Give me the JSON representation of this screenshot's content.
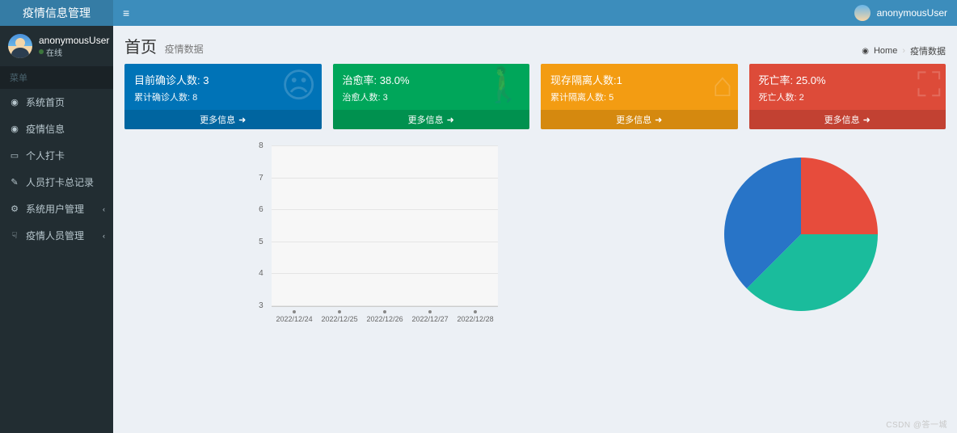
{
  "app": {
    "name": "疫情信息管理"
  },
  "user": {
    "name": "anonymousUser",
    "status": "在线"
  },
  "topbar": {
    "username": "anonymousUser"
  },
  "sidebar": {
    "menu_header": "菜单",
    "items": [
      {
        "icon": "dashboard-icon",
        "label": "系统首页"
      },
      {
        "icon": "dashboard-icon",
        "label": "疫情信息"
      },
      {
        "icon": "laptop-icon",
        "label": "个人打卡"
      },
      {
        "icon": "edit-icon",
        "label": "人员打卡总记录"
      },
      {
        "icon": "cogs-icon",
        "label": "系统用户管理",
        "caret": true
      },
      {
        "icon": "hand-icon",
        "label": "疫情人员管理",
        "caret": true
      }
    ]
  },
  "header": {
    "title": "首页",
    "subtitle": "疫情数据",
    "breadcrumb_home": "Home",
    "breadcrumb_current": "疫情数据"
  },
  "cards": [
    {
      "title": "目前确诊人数:  3",
      "sub": "累计确诊人数:  8",
      "footer": "更多信息",
      "color": "c-blue",
      "bg_icon": "☹"
    },
    {
      "title": "治愈率:  38.0%",
      "sub": "治愈人数:  3",
      "footer": "更多信息",
      "color": "c-green",
      "bg_icon": "🚶"
    },
    {
      "title": "现存隔离人数:1",
      "sub": "累计隔离人数:  5",
      "footer": "更多信息",
      "color": "c-orange",
      "bg_icon": "⌂"
    },
    {
      "title": "死亡率:  25.0%",
      "sub": "死亡人数:  2",
      "footer": "更多信息",
      "color": "c-red",
      "bg_icon": "⛶"
    }
  ],
  "chart_data": [
    {
      "type": "line",
      "categories": [
        "2022/12/24",
        "2022/12/25",
        "2022/12/26",
        "2022/12/27",
        "2022/12/28"
      ],
      "series": [],
      "ylim": [
        3,
        8
      ],
      "yticks": [
        3,
        4,
        5,
        6,
        7,
        8
      ],
      "title": "",
      "xlabel": "",
      "ylabel": ""
    },
    {
      "type": "pie",
      "series": [
        {
          "name": "slice-red",
          "value": 25,
          "color": "#e74c3c"
        },
        {
          "name": "slice-teal",
          "value": 37.5,
          "color": "#1abc9c"
        },
        {
          "name": "slice-blue",
          "value": 37.5,
          "color": "#2874c7"
        }
      ],
      "title": ""
    }
  ],
  "watermark": "CSDN @答一城"
}
